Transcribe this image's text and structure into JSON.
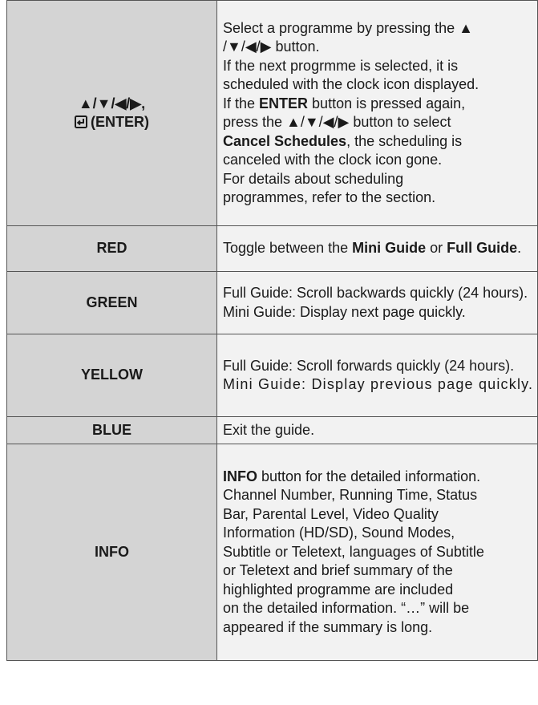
{
  "rows": [
    {
      "key": "▲/▼/◀/▶,",
      "key_enter": "(ENTER)",
      "desc": {
        "l1": "Select a programme by pressing the ▲",
        "l2": "/▼/◀/▶ button.",
        "l3": "If the next progrmme is selected, it is",
        "l4": "scheduled with the clock icon displayed.",
        "l5a": "If the ",
        "l5b": "ENTER",
        "l5c": " button is pressed again,",
        "l6": "press the ▲/▼/◀/▶ button to select",
        "l7a": "Cancel Schedules",
        "l7b": ", the scheduling is",
        "l8": "canceled with the clock icon gone.",
        "l9": "For details about scheduling",
        "l10": "programmes, refer to the section."
      }
    },
    {
      "key": "RED",
      "desc": {
        "p1": "Toggle between the ",
        "b1": "Mini Guide",
        "p2": " or ",
        "b2": "Full Guide",
        "p3": "."
      }
    },
    {
      "key": "GREEN",
      "desc": {
        "l1": "Full Guide: Scroll backwards quickly (24 hours).",
        "l2": "Mini Guide: Display next page quickly."
      }
    },
    {
      "key": "YELLOW",
      "desc": {
        "l1": "Full Guide: Scroll forwards quickly (24 hours).",
        "l2": "Mini Guide: Display previous page quickly."
      }
    },
    {
      "key": "BLUE",
      "desc": {
        "l1": "Exit the guide."
      }
    },
    {
      "key": "INFO",
      "desc": {
        "l1a": "INFO",
        "l1b": " button for the detailed information.",
        "l2": "Channel Number, Running Time, Status",
        "l3": "Bar, Parental Level, Video Quality",
        "l4": "Information (HD/SD), Sound Modes,",
        "l5": "Subtitle or Teletext, languages of Subtitle",
        "l6": "or Teletext and brief summary of the",
        "l7": "highlighted programme are included",
        "l8": "on the detailed information. “…” will be",
        "l9": "appeared if the summary is long."
      }
    }
  ]
}
